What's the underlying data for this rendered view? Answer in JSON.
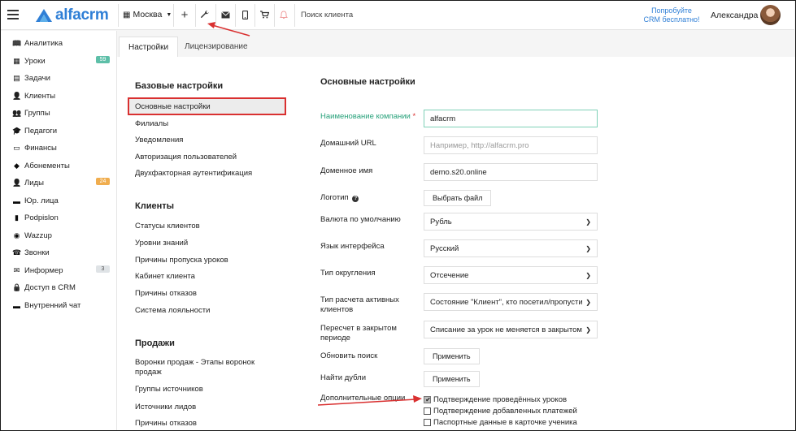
{
  "header": {
    "logo_text": "alfacrm",
    "city": "Москва",
    "search_placeholder": "Поиск клиента",
    "promo_text": "Попробуйте CRM бесплатно!",
    "username": "Александра"
  },
  "sidebar": {
    "items": [
      {
        "label": "Аналитика",
        "icon": "book-icon"
      },
      {
        "label": "Уроки",
        "icon": "calendar-icon",
        "badge": "59"
      },
      {
        "label": "Задачи",
        "icon": "clipboard-icon"
      },
      {
        "label": "Клиенты",
        "icon": "user-icon"
      },
      {
        "label": "Группы",
        "icon": "users-icon"
      },
      {
        "label": "Педагоги",
        "icon": "graduation-cap-icon"
      },
      {
        "label": "Финансы",
        "icon": "money-icon"
      },
      {
        "label": "Абонементы",
        "icon": "tags-icon"
      },
      {
        "label": "Лиды",
        "icon": "user-plus-icon",
        "badge": "24"
      },
      {
        "label": "Юр. лица",
        "icon": "briefcase-icon"
      },
      {
        "label": "Podpislon",
        "icon": "file-icon"
      },
      {
        "label": "Wazzup",
        "icon": "whatsapp-icon"
      },
      {
        "label": "Звонки",
        "icon": "phone-icon"
      },
      {
        "label": "Информер",
        "icon": "envelope-icon",
        "badge": "3"
      },
      {
        "label": "Доступ в CRM",
        "icon": "lock-icon"
      },
      {
        "label": "Внутренний чат",
        "icon": "chat-icon"
      }
    ]
  },
  "tabs": {
    "settings": "Настройки",
    "licensing": "Лицензирование"
  },
  "left_menu": {
    "basic_title": "Базовые настройки",
    "basic_items": [
      "Основные настройки",
      "Филиалы",
      "Уведомления",
      "Авторизация пользователей",
      "Двухфакторная аутентификация"
    ],
    "clients_title": "Клиенты",
    "clients_items": [
      "Статусы клиентов",
      "Уровни знаний",
      "Причины пропуска уроков",
      "Кабинет клиента",
      "Причины отказов",
      "Система лояльности"
    ],
    "sales_title": "Продажи",
    "sales_items": [
      "Воронки продаж - Этапы воронок продаж",
      "Группы источников",
      "Источники лидов",
      "Причины отказов"
    ]
  },
  "form": {
    "title": "Основные настройки",
    "company_label": "Наименование компании",
    "company_required": "*",
    "company_value": "alfacrm",
    "url_label": "Домашний URL",
    "url_placeholder": "Например, http://alfacrm.pro",
    "domain_label": "Доменное имя",
    "domain_value": "demo.s20.online",
    "logo_label": "Логотип",
    "logo_button": "Выбрать файл",
    "currency_label": "Валюта по умолчанию",
    "currency_value": "Рубль",
    "language_label": "Язык интерфейса",
    "language_value": "Русский",
    "rounding_label": "Тип округления",
    "rounding_value": "Отсечение",
    "active_calc_label": "Тип расчета активных клиентов",
    "active_calc_value": "Состояние \"Клиент\", кто посетил/пропусти",
    "recalc_label": "Пересчет в закрытом периоде",
    "recalc_value": "Списание за урок не меняется в закрытом",
    "refresh_label": "Обновить поиск",
    "refresh_button": "Применить",
    "dupes_label": "Найти дубли",
    "dupes_button": "Применить",
    "options_label": "Дополнительные опции",
    "options": [
      {
        "label": "Подтверждение проведённых уроков",
        "checked": true
      },
      {
        "label": "Подтверждение добавленных платежей",
        "checked": false
      },
      {
        "label": "Паспортные данные в карточке ученика",
        "checked": false
      }
    ]
  },
  "colors": {
    "brand": "#2f7fd6",
    "accent_green": "#27a17a",
    "annotation_red": "#d93030"
  }
}
